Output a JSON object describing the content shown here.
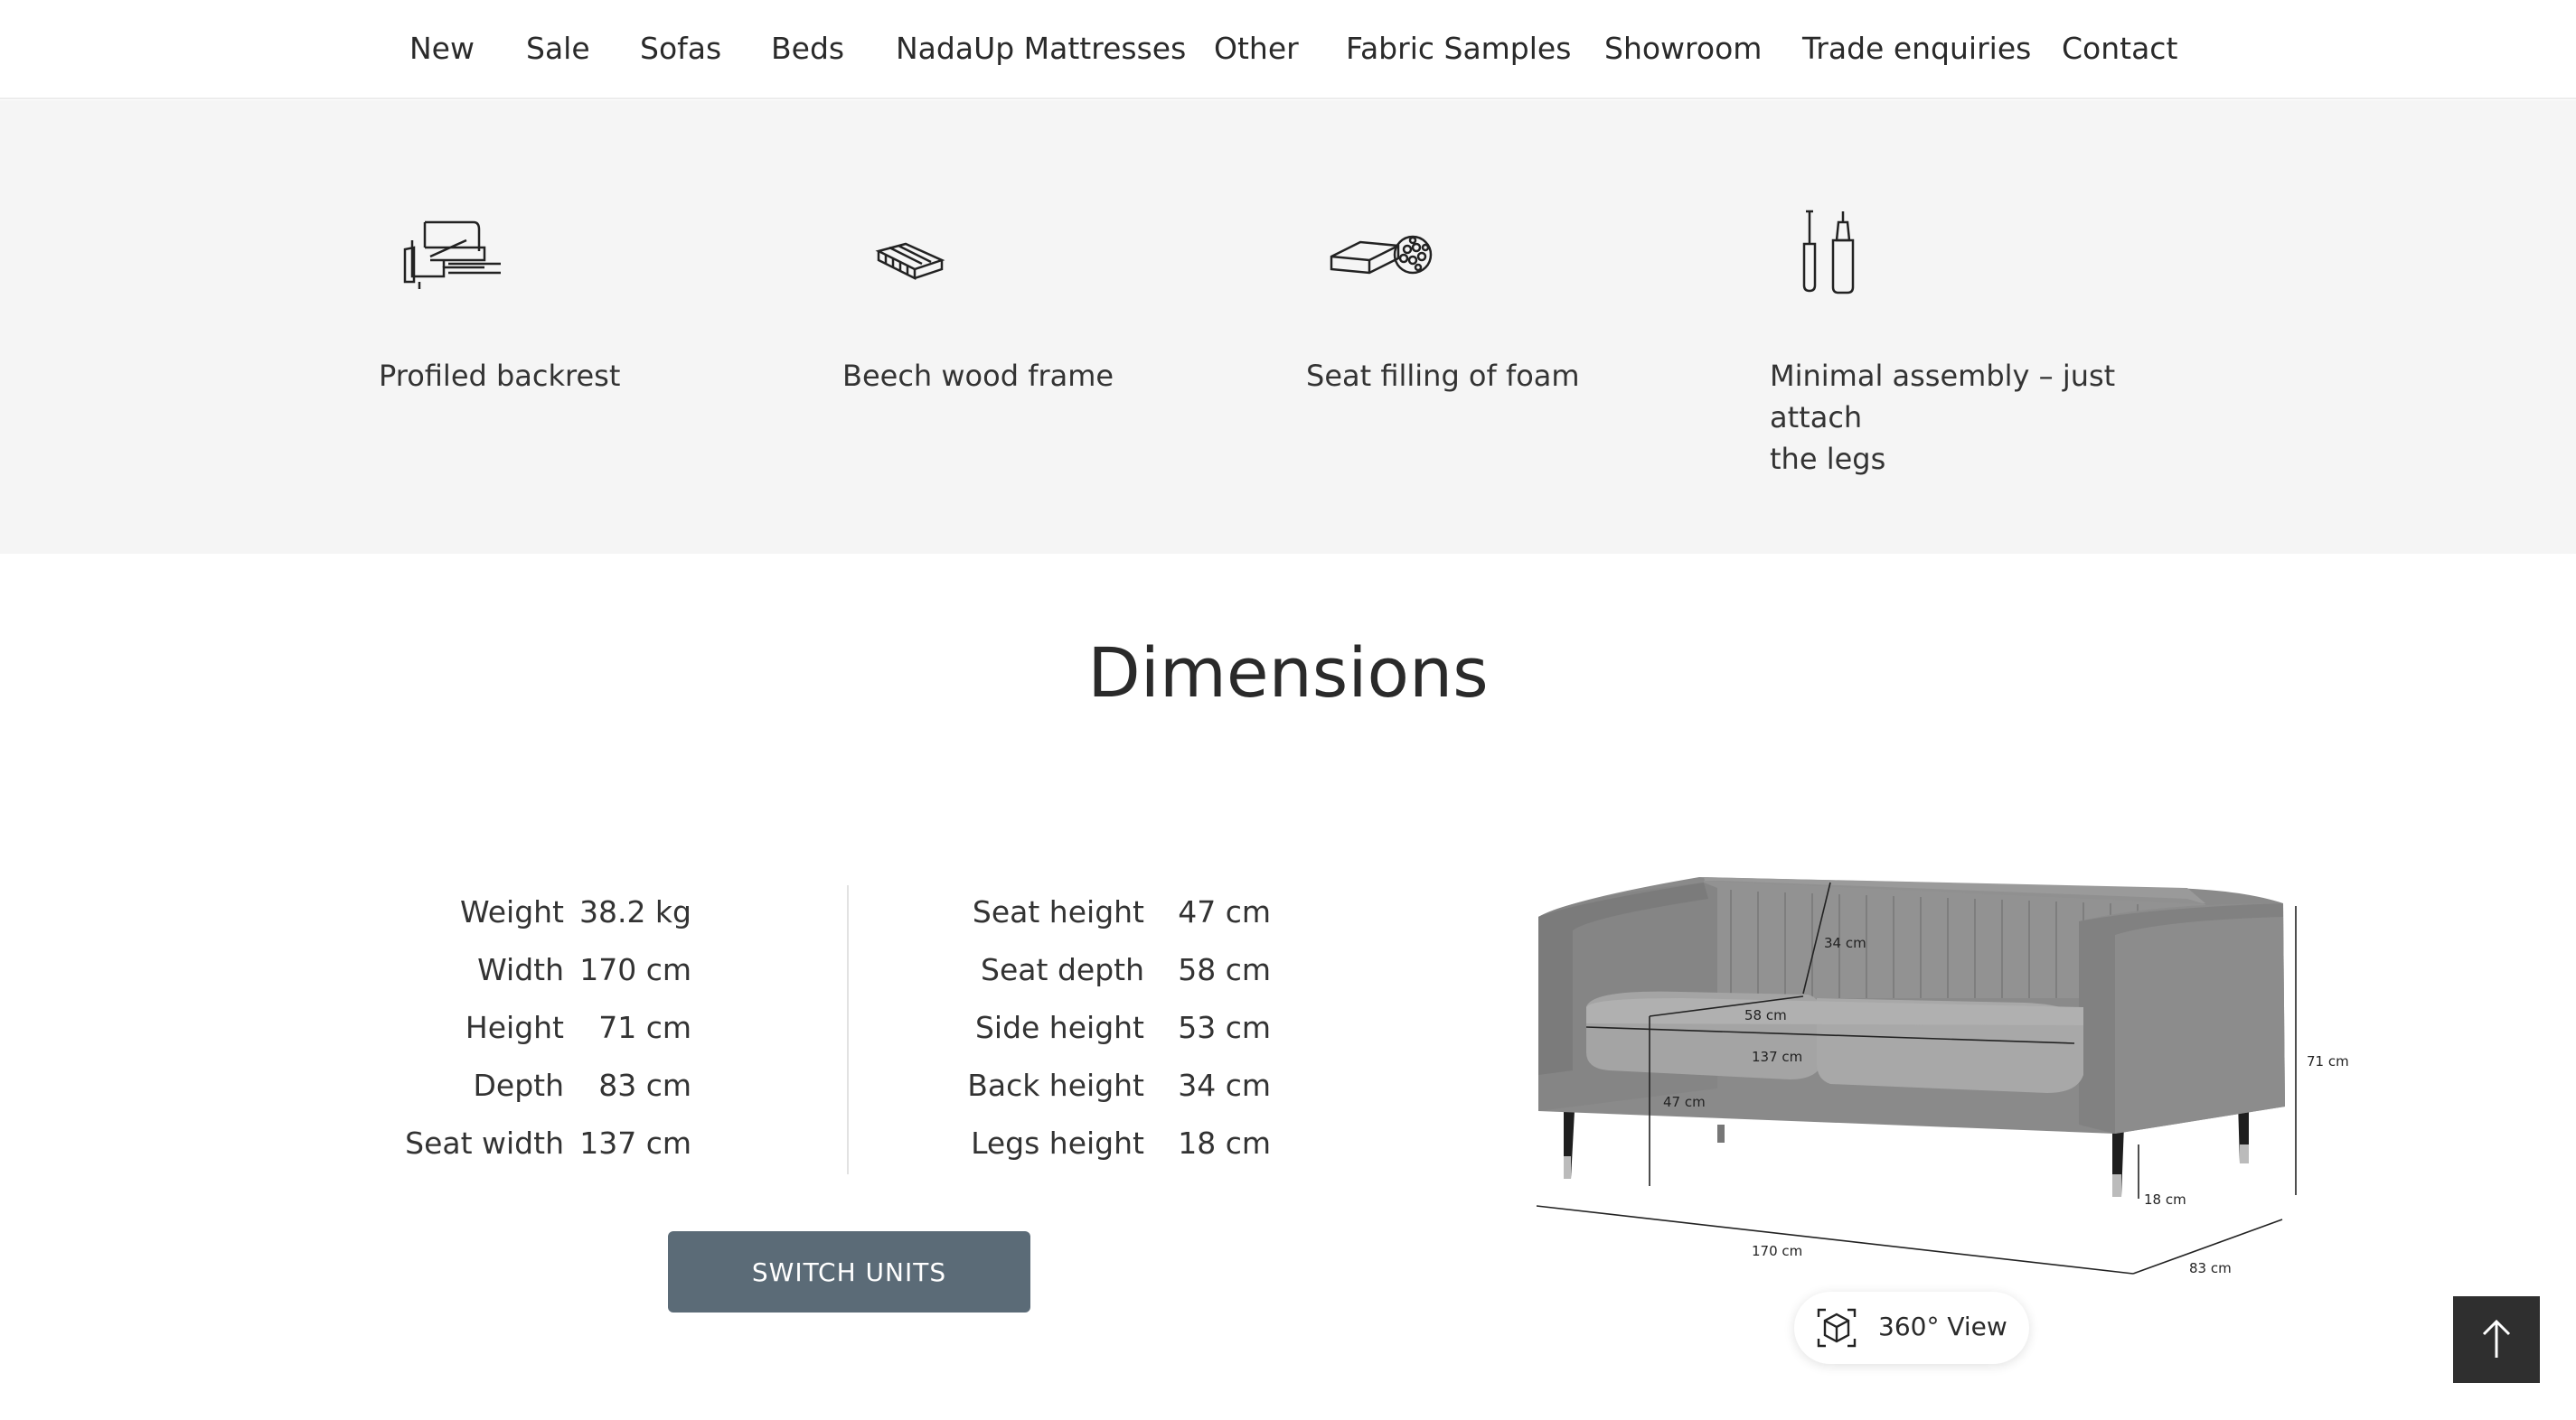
{
  "nav": {
    "items": [
      {
        "label": "New"
      },
      {
        "label": "Sale"
      },
      {
        "label": "Sofas"
      },
      {
        "label": "Beds"
      },
      {
        "label": "NadaUp Mattresses"
      },
      {
        "label": "Other"
      },
      {
        "label": "Fabric Samples"
      },
      {
        "label": "Showroom"
      },
      {
        "label": "Trade enquiries"
      },
      {
        "label": "Contact"
      }
    ]
  },
  "features": [
    {
      "icon": "sofa-backrest-icon",
      "label": "Profiled backrest"
    },
    {
      "icon": "wood-frame-icon",
      "label": "Beech wood frame"
    },
    {
      "icon": "foam-filling-icon",
      "label": "Seat filling of foam"
    },
    {
      "icon": "assembly-tools-icon",
      "label_line1": "Minimal assembly – just attach",
      "label_line2": "the legs"
    }
  ],
  "dimensions": {
    "title": "Dimensions",
    "left": [
      {
        "label": "Weight",
        "value": "38.2 kg"
      },
      {
        "label": "Width",
        "value": "170 cm"
      },
      {
        "label": "Height",
        "value": "71 cm"
      },
      {
        "label": "Depth",
        "value": "83 cm"
      },
      {
        "label": "Seat width",
        "value": "137 cm"
      }
    ],
    "right": [
      {
        "label": "Seat height",
        "value": "47 cm"
      },
      {
        "label": "Seat depth",
        "value": "58 cm"
      },
      {
        "label": "Side height",
        "value": "53 cm"
      },
      {
        "label": "Back height",
        "value": "34 cm"
      },
      {
        "label": "Legs height",
        "value": "18 cm"
      }
    ],
    "switch_label": "SWITCH UNITS"
  },
  "diagram": {
    "back_height": "34 cm",
    "seat_depth": "58 cm",
    "seat_width": "137 cm",
    "seat_height": "47 cm",
    "height": "71 cm",
    "legs": "18 cm",
    "width": "170 cm",
    "depth": "83 cm"
  },
  "view360": {
    "label": "360° View"
  },
  "colors": {
    "button": "#5b6b77",
    "feature_bg": "#f5f5f5",
    "to_top_bg": "#2f2f2f"
  }
}
